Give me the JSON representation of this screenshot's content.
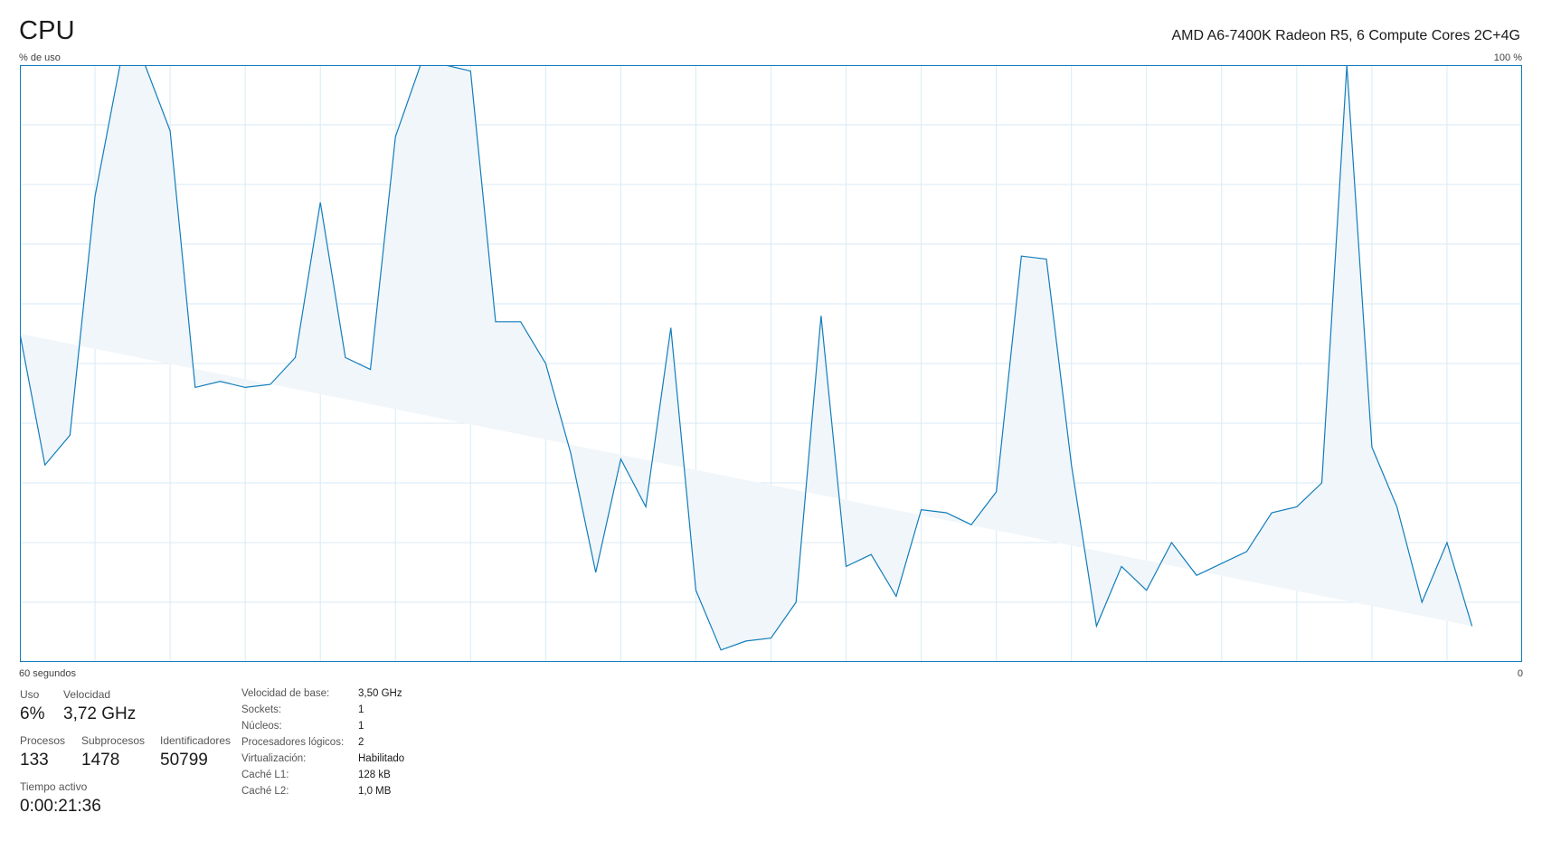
{
  "header": {
    "title": "CPU",
    "model": "AMD A6-7400K Radeon R5, 6 Compute Cores 2C+4G"
  },
  "chart_data": {
    "type": "area",
    "ylabel": "% de uso",
    "y_max_label": "100 %",
    "xlabel": "60 segundos",
    "x_min_label": "0",
    "ylim": [
      0,
      100
    ],
    "x": [
      60,
      59,
      58,
      57,
      56,
      55,
      54,
      53,
      52,
      51,
      50,
      49,
      48,
      47,
      46,
      45,
      44,
      43,
      42,
      41,
      40,
      39,
      38,
      37,
      36,
      35,
      34,
      33,
      32,
      31,
      30,
      29,
      28,
      27,
      26,
      25,
      24,
      23,
      22,
      21,
      20,
      19,
      18,
      17,
      16,
      15,
      14,
      13,
      12,
      11,
      10,
      9,
      8,
      7,
      6,
      5,
      4,
      3,
      2,
      1,
      0
    ],
    "values": [
      55,
      33,
      38,
      78,
      100,
      100,
      89,
      46,
      47,
      46,
      46.5,
      51,
      77,
      51,
      49,
      88,
      100,
      100,
      99,
      57,
      57,
      50,
      35,
      15,
      34,
      26,
      56,
      12,
      2,
      3.5,
      4,
      10,
      58,
      16,
      18,
      11,
      25.5,
      25,
      23,
      28.5,
      68,
      67.5,
      33,
      6,
      16,
      12,
      20,
      14.5,
      16.5,
      18.5,
      25,
      26,
      30,
      100,
      36,
      26,
      10,
      20,
      6
    ],
    "stroke_color": "#117dbb",
    "fill_color": "#f1f6fa",
    "grid_color": "#d9eaf4",
    "grid": true,
    "grid_rows": 10,
    "grid_cols": 20
  },
  "stats": {
    "uso_label": "Uso",
    "uso_value": "6%",
    "velocidad_label": "Velocidad",
    "velocidad_value": "3,72 GHz",
    "procesos_label": "Procesos",
    "procesos_value": "133",
    "subprocesos_label": "Subprocesos",
    "subprocesos_value": "1478",
    "identificadores_label": "Identificadores",
    "identificadores_value": "50799",
    "tiempo_label": "Tiempo activo",
    "tiempo_value": "0:00:21:36"
  },
  "specs": [
    {
      "label": "Velocidad de base:",
      "value": "3,50 GHz"
    },
    {
      "label": "Sockets:",
      "value": "1"
    },
    {
      "label": "Núcleos:",
      "value": "1"
    },
    {
      "label": "Procesadores lógicos:",
      "value": "2"
    },
    {
      "label": "Virtualización:",
      "value": "Habilitado"
    },
    {
      "label": "Caché L1:",
      "value": "128 kB"
    },
    {
      "label": "Caché L2:",
      "value": "1,0 MB"
    }
  ]
}
